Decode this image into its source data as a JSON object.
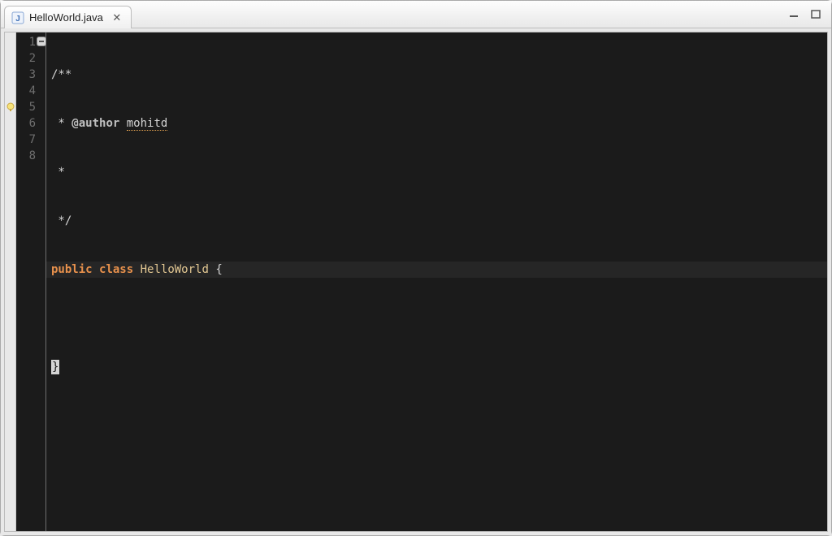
{
  "tab": {
    "filename": "HelloWorld.java",
    "close_glyph": "✕"
  },
  "gutter": {
    "lines": [
      "1",
      "2",
      "3",
      "4",
      "5",
      "6",
      "7",
      "8"
    ],
    "quickfix_line": 5,
    "fold_line": 1
  },
  "code": {
    "l1_open": "/**",
    "l2_prefix": " * ",
    "l2_tag": "@author",
    "l2_space": " ",
    "l2_name": "mohitd",
    "l3": " *",
    "l4": " */",
    "l5_kw1": "public",
    "l5_sp1": " ",
    "l5_kw2": "class",
    "l5_sp2": " ",
    "l5_classname": "HelloWorld",
    "l5_sp3": " ",
    "l5_brace_open": "{",
    "l6": "",
    "l7_brace_close": "}",
    "l8": ""
  }
}
